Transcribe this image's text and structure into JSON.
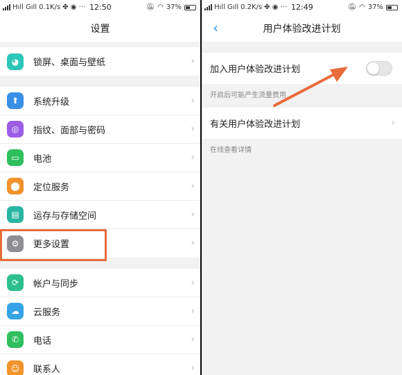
{
  "left": {
    "status": {
      "carrier": "Hıll Gıll",
      "speed": "0.1K/s",
      "time": "12:50",
      "battery": "37%"
    },
    "title": "设置",
    "groups": [
      [
        {
          "label": "锁屏、桌面与壁纸",
          "icon": "palette-icon",
          "color": "#2cc6b8"
        }
      ],
      [
        {
          "label": "系统升级",
          "icon": "system-update-icon",
          "color": "#3a8fe6"
        },
        {
          "label": "指纹、面部与密码",
          "icon": "fingerprint-icon",
          "color": "#9b5de5"
        },
        {
          "label": "电池",
          "icon": "battery-icon",
          "color": "#2fbf5f"
        },
        {
          "label": "定位服务",
          "icon": "location-icon",
          "color": "#f2932b"
        },
        {
          "label": "运存与存储空间",
          "icon": "storage-icon",
          "color": "#28b5a3"
        },
        {
          "label": "更多设置",
          "icon": "more-settings-icon",
          "color": "#8e8e93"
        }
      ],
      [
        {
          "label": "帐户与同步",
          "icon": "account-sync-icon",
          "color": "#2fbf8f"
        },
        {
          "label": "云服务",
          "icon": "cloud-icon",
          "color": "#35a3e6"
        },
        {
          "label": "电话",
          "icon": "phone-icon",
          "color": "#2fbf5f"
        },
        {
          "label": "联系人",
          "icon": "contacts-icon",
          "color": "#f2932b"
        }
      ]
    ]
  },
  "right": {
    "status": {
      "carrier": "Hıll Gıll",
      "speed": "0.2K/s",
      "time": "12:49",
      "battery": "37%"
    },
    "title": "用户体验改进计划",
    "join_label": "加入用户体验改进计划",
    "join_hint": "开启后可能产生流量费用",
    "join_enabled": false,
    "about_label": "有关用户体验改进计划",
    "about_hint": "在线查看详情"
  },
  "colors": {
    "accent": "#3a8fe6",
    "highlight": "#e86b3a"
  }
}
